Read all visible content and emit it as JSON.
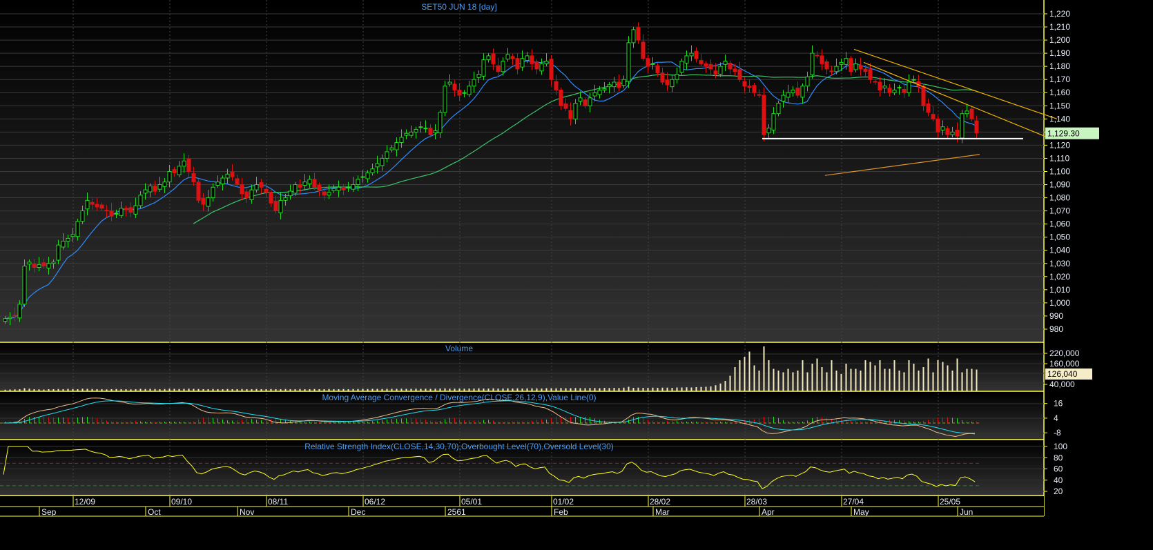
{
  "chart_data": [
    {
      "type": "candlestick",
      "title": "SET50 JUN 18   [day]",
      "instrument": "SET50 JUN 18",
      "interval": "day",
      "yticks": [
        980,
        990,
        1000,
        1010,
        1020,
        1030,
        1040,
        1050,
        1060,
        1070,
        1080,
        1090,
        1100,
        1110,
        1120,
        1130,
        1140,
        1150,
        1160,
        1170,
        1180,
        1190,
        1200,
        1210,
        1220
      ],
      "ylim": [
        974,
        1228
      ],
      "last_price": "1,129.30",
      "closes": [
        988,
        989,
        990,
        999,
        1028,
        1031,
        1027,
        1029,
        1028,
        1030,
        1031,
        1044,
        1047,
        1049,
        1052,
        1062,
        1070,
        1078,
        1075,
        1073,
        1072,
        1070,
        1066,
        1068,
        1072,
        1071,
        1069,
        1074,
        1082,
        1086,
        1089,
        1085,
        1090,
        1092,
        1100,
        1099,
        1104,
        1108,
        1100,
        1092,
        1078,
        1075,
        1080,
        1088,
        1092,
        1095,
        1098,
        1096,
        1090,
        1083,
        1080,
        1086,
        1090,
        1088,
        1084,
        1076,
        1070,
        1078,
        1080,
        1085,
        1090,
        1088,
        1092,
        1094,
        1088,
        1086,
        1082,
        1084,
        1087,
        1088,
        1086,
        1088,
        1090,
        1094,
        1096,
        1099,
        1102,
        1106,
        1110,
        1115,
        1118,
        1122,
        1126,
        1129,
        1130,
        1132,
        1134,
        1133,
        1128,
        1131,
        1145,
        1165,
        1168,
        1162,
        1158,
        1160,
        1165,
        1170,
        1174,
        1185,
        1188,
        1182,
        1176,
        1184,
        1189,
        1186,
        1178,
        1186,
        1188,
        1182,
        1178,
        1182,
        1184,
        1170,
        1162,
        1150,
        1148,
        1140,
        1152,
        1156,
        1150,
        1156,
        1160,
        1162,
        1163,
        1166,
        1168,
        1164,
        1170,
        1198,
        1208,
        1200,
        1186,
        1180,
        1182,
        1175,
        1168,
        1166,
        1170,
        1174,
        1184,
        1188,
        1190,
        1186,
        1182,
        1180,
        1178,
        1174,
        1180,
        1184,
        1178,
        1176,
        1170,
        1165,
        1164,
        1160,
        1158,
        1128,
        1133,
        1144,
        1152,
        1158,
        1160,
        1162,
        1158,
        1165,
        1172,
        1190,
        1188,
        1182,
        1178,
        1176,
        1180,
        1183,
        1186,
        1176,
        1182,
        1178,
        1176,
        1170,
        1168,
        1162,
        1165,
        1160,
        1162,
        1164,
        1160,
        1168,
        1170,
        1165,
        1150,
        1145,
        1140,
        1130,
        1134,
        1128,
        1130,
        1127,
        1144,
        1146,
        1140,
        1129.3
      ],
      "moving_averages": [
        {
          "period": 10,
          "color": "#2f8cff"
        },
        {
          "period": 40,
          "color": "#3cc46a"
        }
      ],
      "drawings": [
        {
          "kind": "trendline",
          "color": "#f0b400",
          "from": {
            "bar": 176,
            "price": 1193
          },
          "to": {
            "bar": 218,
            "price": 1140
          }
        },
        {
          "kind": "trendline",
          "color": "#f0b400",
          "from": {
            "bar": 178,
            "price": 1183
          },
          "to": {
            "bar": 216,
            "price": 1126
          }
        },
        {
          "kind": "horizontal",
          "color": "#ffffff",
          "price": 1125,
          "from_bar": 157,
          "to_bar": 211
        },
        {
          "kind": "line",
          "color": "#e0952a",
          "from": {
            "bar": 170,
            "price": 1097
          },
          "to": {
            "bar": 202,
            "price": 1113
          }
        }
      ],
      "colors": {
        "up": "#22dd22",
        "down": "#dd1111"
      }
    },
    {
      "type": "bar",
      "title": "Volume",
      "yticks": [
        {
          "value": 40000,
          "label": "40,000"
        },
        {
          "value": 160000,
          "label": "160,000"
        },
        {
          "value": 220000,
          "label": "220,000"
        }
      ],
      "last_value": "126,040",
      "color": "#f5e9c0",
      "values": [
        9000,
        10000,
        11000,
        12000,
        18000,
        15000,
        12000,
        11000,
        10000,
        12000,
        12000,
        13000,
        12000,
        14000,
        13000,
        12000,
        15000,
        14000,
        13000,
        12000,
        12000,
        11000,
        12000,
        13000,
        12000,
        12000,
        11000,
        12000,
        14000,
        13000,
        14000,
        13000,
        12000,
        13000,
        15000,
        14000,
        13000,
        14000,
        15000,
        14000,
        13000,
        12000,
        12000,
        13000,
        12000,
        12000,
        13000,
        12000,
        12000,
        13000,
        12000,
        12000,
        13000,
        12000,
        12000,
        13000,
        12000,
        12000,
        13000,
        12000,
        12000,
        13000,
        12000,
        12000,
        13000,
        12000,
        12000,
        13000,
        12000,
        12000,
        13000,
        12000,
        13000,
        13000,
        14000,
        13000,
        14000,
        14000,
        13000,
        14000,
        14000,
        14000,
        15000,
        14000,
        14000,
        15000,
        14000,
        15000,
        14000,
        15000,
        16000,
        17000,
        15000,
        15000,
        16000,
        15000,
        16000,
        16000,
        17000,
        16000,
        16000,
        17000,
        16000,
        16000,
        17000,
        16000,
        17000,
        16000,
        17000,
        17000,
        17000,
        16000,
        18000,
        18000,
        17000,
        19000,
        18000,
        18000,
        19000,
        18000,
        18000,
        19000,
        19000,
        18000,
        20000,
        19000,
        20000,
        19000,
        21000,
        26000,
        20000,
        21000,
        20000,
        20000,
        21000,
        20000,
        21000,
        21000,
        20000,
        22000,
        22000,
        23000,
        22000,
        24000,
        25000,
        26000,
        28000,
        35000,
        45000,
        60000,
        90000,
        140000,
        180000,
        200000,
        230000,
        150000,
        120000,
        260000,
        180000,
        130000,
        120000,
        110000,
        130000,
        110000,
        120000,
        180000,
        110000,
        160000,
        190000,
        140000,
        110000,
        180000,
        120000,
        100000,
        160000,
        130000,
        130000,
        120000,
        180000,
        170000,
        150000,
        180000,
        130000,
        130000,
        180000,
        120000,
        110000,
        180000,
        160000,
        120000,
        140000,
        190000,
        110000,
        180000,
        170000,
        150000,
        120000,
        190000,
        110000,
        130000,
        130000,
        126040
      ]
    },
    {
      "type": "line",
      "title": "Moving Average Convergence / Divergence(CLOSE,26,12,9),Value Line(0)",
      "yticks": [
        16,
        4,
        -8
      ],
      "params": {
        "slow": 26,
        "fast": 12,
        "signal": 9,
        "value_line": 0
      },
      "colors": {
        "macd": "#f0c090",
        "signal": "#22e0f0",
        "hist_up": "#22dd22",
        "hist_down": "#dd1111",
        "value_line": "#9a9a20"
      }
    },
    {
      "type": "line",
      "title": "Relative Strength Index(CLOSE,14,30,70),Overbought Level(70),Oversold Level(30)",
      "yticks": [
        20,
        40,
        60,
        80,
        100
      ],
      "params": {
        "period": 14,
        "overbought": 70,
        "oversold": 30
      },
      "colors": {
        "rsi": "#ffff20",
        "overbought": "#b0104a",
        "oversold": "#1a8a1a"
      }
    }
  ],
  "x_axis": {
    "dates": [
      {
        "label": "12/09",
        "bar": 14
      },
      {
        "label": "09/10",
        "bar": 34
      },
      {
        "label": "08/11",
        "bar": 54
      },
      {
        "label": "06/12",
        "bar": 74
      },
      {
        "label": "05/01",
        "bar": 94
      },
      {
        "label": "01/02",
        "bar": 113
      },
      {
        "label": "28/02",
        "bar": 133
      },
      {
        "label": "28/03",
        "bar": 153
      },
      {
        "label": "27/04",
        "bar": 173
      },
      {
        "label": "25/05",
        "bar": 193
      }
    ],
    "months": [
      {
        "label": "Sep",
        "bar": 7
      },
      {
        "label": "Oct",
        "bar": 29
      },
      {
        "label": "Nov",
        "bar": 48
      },
      {
        "label": "Dec",
        "bar": 71
      },
      {
        "label": "2561",
        "bar": 91
      },
      {
        "label": "Feb",
        "bar": 113
      },
      {
        "label": "Mar",
        "bar": 134
      },
      {
        "label": "Apr",
        "bar": 156
      },
      {
        "label": "May",
        "bar": 175
      },
      {
        "label": "Jun",
        "bar": 197
      }
    ]
  }
}
